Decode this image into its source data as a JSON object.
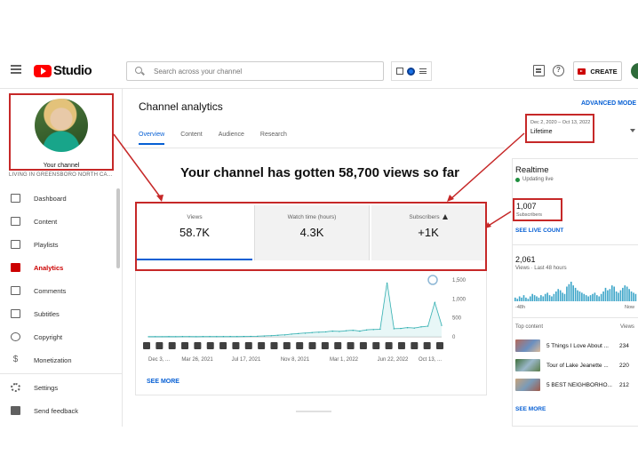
{
  "header": {
    "logo_text": "Studio",
    "search_placeholder": "Search across your channel",
    "create_label": "CREATE"
  },
  "sidebar": {
    "channel_label": "Your channel",
    "channel_subtitle": "LIVING IN GREENSBORO NORTH CA...",
    "items": [
      {
        "label": "Dashboard",
        "icon": "dashboard-icon"
      },
      {
        "label": "Content",
        "icon": "content-icon"
      },
      {
        "label": "Playlists",
        "icon": "playlists-icon"
      },
      {
        "label": "Analytics",
        "icon": "analytics-icon",
        "active": true
      },
      {
        "label": "Comments",
        "icon": "comments-icon"
      },
      {
        "label": "Subtitles",
        "icon": "subtitles-icon"
      },
      {
        "label": "Copyright",
        "icon": "copyright-icon"
      },
      {
        "label": "Monetization",
        "icon": "monetization-icon"
      },
      {
        "label": "Settings",
        "icon": "settings-icon"
      },
      {
        "label": "Send feedback",
        "icon": "feedback-icon"
      }
    ]
  },
  "main": {
    "title": "Channel analytics",
    "advanced_mode": "ADVANCED MODE",
    "tabs": [
      "Overview",
      "Content",
      "Audience",
      "Research"
    ],
    "active_tab": "Overview",
    "date_range": "Dec 2, 2020 – Oct 13, 2022",
    "date_selection": "Lifetime",
    "headline": "Your channel has gotten 58,700 views so far",
    "metrics": [
      {
        "label": "Views",
        "value": "58.7K"
      },
      {
        "label": "Watch time (hours)",
        "value": "4.3K"
      },
      {
        "label": "Subscribers",
        "value": "+1K"
      }
    ],
    "see_more": "SEE MORE"
  },
  "chart_data": {
    "type": "line",
    "x_tick_labels": [
      "Dec 3, ...",
      "Mar 26, 2021",
      "Jul 17, 2021",
      "Nov 8, 2021",
      "Mar 1, 2022",
      "Jun 22, 2022",
      "Oct 13, ..."
    ],
    "y_tick_labels": [
      "1,500",
      "1,000",
      "500",
      "0"
    ],
    "ylim": [
      0,
      1500
    ],
    "grid": false,
    "series": [
      {
        "values": [
          2,
          3,
          2,
          4,
          3,
          5,
          4,
          3,
          6,
          5,
          4,
          6,
          8,
          7,
          10,
          12,
          15,
          20,
          28,
          40,
          50,
          70,
          85,
          95,
          110,
          120,
          130,
          150,
          140,
          160,
          170,
          150,
          180,
          190,
          200,
          1420,
          210,
          220,
          240,
          230,
          260,
          280,
          900,
          300
        ]
      }
    ],
    "marker_icons": [
      "short-icon",
      "short-icon",
      "play-icon",
      "play-icon",
      "short-icon",
      "short-icon",
      "short-icon",
      "short-icon",
      "play-icon",
      "play-icon",
      "play-icon",
      "play-icon",
      "play-icon",
      "play-icon",
      "short-icon",
      "play-icon",
      "short-icon",
      "short-icon",
      "short-icon",
      "short-icon",
      "play-icon",
      "play-icon",
      "play-icon",
      "play-icon"
    ]
  },
  "realtime": {
    "title": "Realtime",
    "live_text": "Updating live",
    "subs_value": "1,007",
    "subs_label": "Subscribers",
    "live_count_link": "SEE LIVE COUNT",
    "views_value": "2,061",
    "views_label": "Views · Last 48 hours",
    "mini_left": "-48h",
    "mini_right": "Now",
    "top_content_label": "Top content",
    "top_content_views_label": "Views",
    "top_content": [
      {
        "title": "5 Things I Love About ...",
        "views": "234"
      },
      {
        "title": "Tour of Lake Jeanette ...",
        "views": "220"
      },
      {
        "title": "5 BEST NEIGHBORHO...",
        "views": "212"
      }
    ],
    "see_more": "SEE MORE",
    "mini_bars": [
      3,
      2,
      4,
      3,
      5,
      3,
      2,
      4,
      6,
      5,
      4,
      3,
      5,
      4,
      6,
      7,
      5,
      4,
      6,
      8,
      10,
      9,
      7,
      6,
      12,
      14,
      16,
      13,
      11,
      9,
      8,
      7,
      6,
      5,
      4,
      5,
      6,
      7,
      5,
      4,
      6,
      8,
      11,
      9,
      10,
      13,
      12,
      8,
      7,
      9,
      11,
      13,
      12,
      10,
      8,
      7,
      6
    ]
  },
  "colors": {
    "accent_blue": "#065fd4",
    "annotation_red": "#c62828",
    "youtube_red": "#ff0000",
    "chart_line": "#18a5a7"
  }
}
